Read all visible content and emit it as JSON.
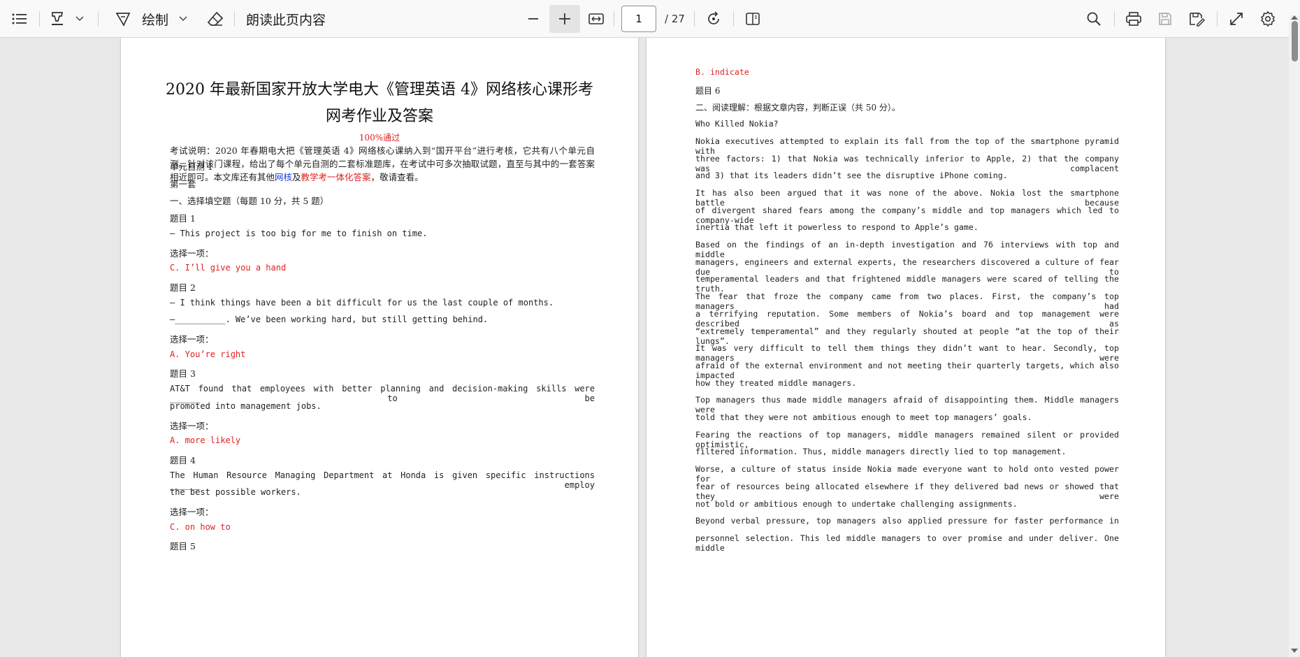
{
  "toolbar": {
    "draw_label": "绘制",
    "read_aloud_label": "朗读此页内容",
    "page_number": "1",
    "page_total": "/ 27",
    "icons": [
      "contents-icon",
      "highlight-icon",
      "chevron-down-icon",
      "draw-icon",
      "chevron-down-icon",
      "eraser-icon",
      "zoom-out-icon",
      "zoom-in-icon",
      "fit-width-icon",
      "rotate-icon",
      "two-page-icon",
      "search-icon",
      "print-icon",
      "save-icon",
      "save-as-icon",
      "fullscreen-icon",
      "settings-icon"
    ]
  },
  "page1": {
    "title_line1": "2020 年最新国家开放大学电大《管理英语 4》网络核心课形考",
    "title_line2": "网考作业及答案",
    "pass_badge": "100%通过",
    "intro_part1": "考试说明：2020 年春期电大把《管理英语 4》网络核心课纳入到“国开平台”进行考核，它共有八个单元自测。针对该门课程，给出了每个单元自测的二套标准题库，在考试中可多次抽取试题，直至与其中的一套答案相近即可。本文库还有其他",
    "intro_link1": "网核",
    "intro_mid": "及",
    "intro_link2": "教学考一体化答案",
    "intro_end": "，敬请查看。",
    "lines": [
      {
        "text": "单元自测 1",
        "style": "cn"
      },
      {
        "text": "第一套",
        "style": "cn"
      },
      {
        "text": "一、选择填空题（每题 10 分，共 5 题）",
        "style": "cn"
      },
      {
        "text": "题目 1",
        "style": "cn"
      },
      {
        "text": "— This project is too big for me to finish on time.",
        "style": "mono"
      },
      {
        "text": "选择一项：",
        "style": "cn"
      },
      {
        "text": "C. I’ll give you a hand",
        "style": "ans"
      },
      {
        "text": "题目 2",
        "style": "cn"
      },
      {
        "text": "— I think things have been a bit difficult for us the last couple of months.",
        "style": "mono"
      },
      {
        "text": "—__________. We’ve been working hard, but still getting behind.",
        "style": "mono"
      },
      {
        "text": "选择一项：",
        "style": "cn"
      },
      {
        "text": "A. You’re right",
        "style": "ans"
      },
      {
        "text": "题目 3",
        "style": "cn"
      },
      {
        "text": "AT&T found that employees with better planning and decision-making skills were ______ to be",
        "style": "mono-just"
      },
      {
        "text": "promoted into management jobs.",
        "style": "mono"
      },
      {
        "text": "选择一项：",
        "style": "cn"
      },
      {
        "text": "A. more likely",
        "style": "ans"
      },
      {
        "text": "题目 4",
        "style": "cn"
      },
      {
        "text": "The Human Resource Managing Department at Honda is given specific instructions ______ employ",
        "style": "mono-just"
      },
      {
        "text": "the best possible workers.",
        "style": "mono"
      },
      {
        "text": "选择一项：",
        "style": "cn"
      },
      {
        "text": "C. on how to",
        "style": "ans"
      },
      {
        "text": "题目 5",
        "style": "cn"
      }
    ]
  },
  "page2": {
    "lines": [
      {
        "text": "B. indicate",
        "style": "ans"
      },
      {
        "text": "题目 6",
        "style": "cn"
      },
      {
        "text": "二、阅读理解：根据文章内容，判断正误（共 50 分）。",
        "style": "cn"
      },
      {
        "text": "Who Killed Nokia?",
        "style": "mono"
      },
      {
        "text": "    Nokia executives attempted to explain its fall from the top of the smartphone pyramid with",
        "style": "mono-just"
      },
      {
        "text": "three factors: 1) that Nokia was technically inferior to Apple, 2) that the company was complacent",
        "style": "mono-just"
      },
      {
        "text": "and 3) that its leaders didn’t see the disruptive iPhone coming.",
        "style": "mono"
      },
      {
        "text": "    It has also been argued that it was none of the above. Nokia lost the smartphone battle because",
        "style": "mono-just"
      },
      {
        "text": "of divergent shared fears among the company’s middle and top managers which led to company-wide",
        "style": "mono-just"
      },
      {
        "text": "inertia that left it powerless to respond to Apple’s game.",
        "style": "mono"
      },
      {
        "text": "    Based on the findings of an in-depth investigation and 76 interviews with top and middle",
        "style": "mono-just"
      },
      {
        "text": "managers, engineers and external experts, the researchers discovered a culture of fear due to",
        "style": "mono-just"
      },
      {
        "text": "temperamental leaders and that frightened middle managers were scared of telling the truth.",
        "style": "mono-just"
      },
      {
        "text": "    The fear that froze the company came from two places. First, the company’s top managers had",
        "style": "mono-just"
      },
      {
        "text": "a terrifying reputation. Some members of Nokia’s board and top management were described as",
        "style": "mono-just"
      },
      {
        "text": "“extremely temperamental” and they regularly shouted at people “at the top of their lungs”.",
        "style": "mono-just"
      },
      {
        "text": "It was very difficult to tell them things they didn’t want to hear. Secondly, top managers were",
        "style": "mono-just"
      },
      {
        "text": "afraid of the external environment and not meeting their quarterly targets, which also impacted",
        "style": "mono-just"
      },
      {
        "text": "how they treated middle managers.",
        "style": "mono"
      },
      {
        "text": "    Top managers thus made middle managers afraid of disappointing them. Middle managers were",
        "style": "mono-just"
      },
      {
        "text": "told that they were not ambitious enough to meet top managers’ goals.",
        "style": "mono"
      },
      {
        "text": "    Fearing the reactions of top managers, middle managers remained silent or provided optimistic,",
        "style": "mono-just"
      },
      {
        "text": "filtered information. Thus, middle managers directly lied to top management.",
        "style": "mono"
      },
      {
        "text": "    Worse, a culture of status inside Nokia made everyone want to hold onto vested power for",
        "style": "mono-just"
      },
      {
        "text": "fear of resources being allocated elsewhere if they delivered bad news or showed that they were",
        "style": "mono-just"
      },
      {
        "text": "not bold or ambitious enough to undertake challenging assignments.",
        "style": "mono"
      },
      {
        "text": "    Beyond verbal pressure, top managers also applied pressure for faster performance in",
        "style": "mono-just"
      },
      {
        "text": "personnel selection. This led middle managers to over promise and under deliver. One middle",
        "style": "mono-just"
      }
    ]
  }
}
